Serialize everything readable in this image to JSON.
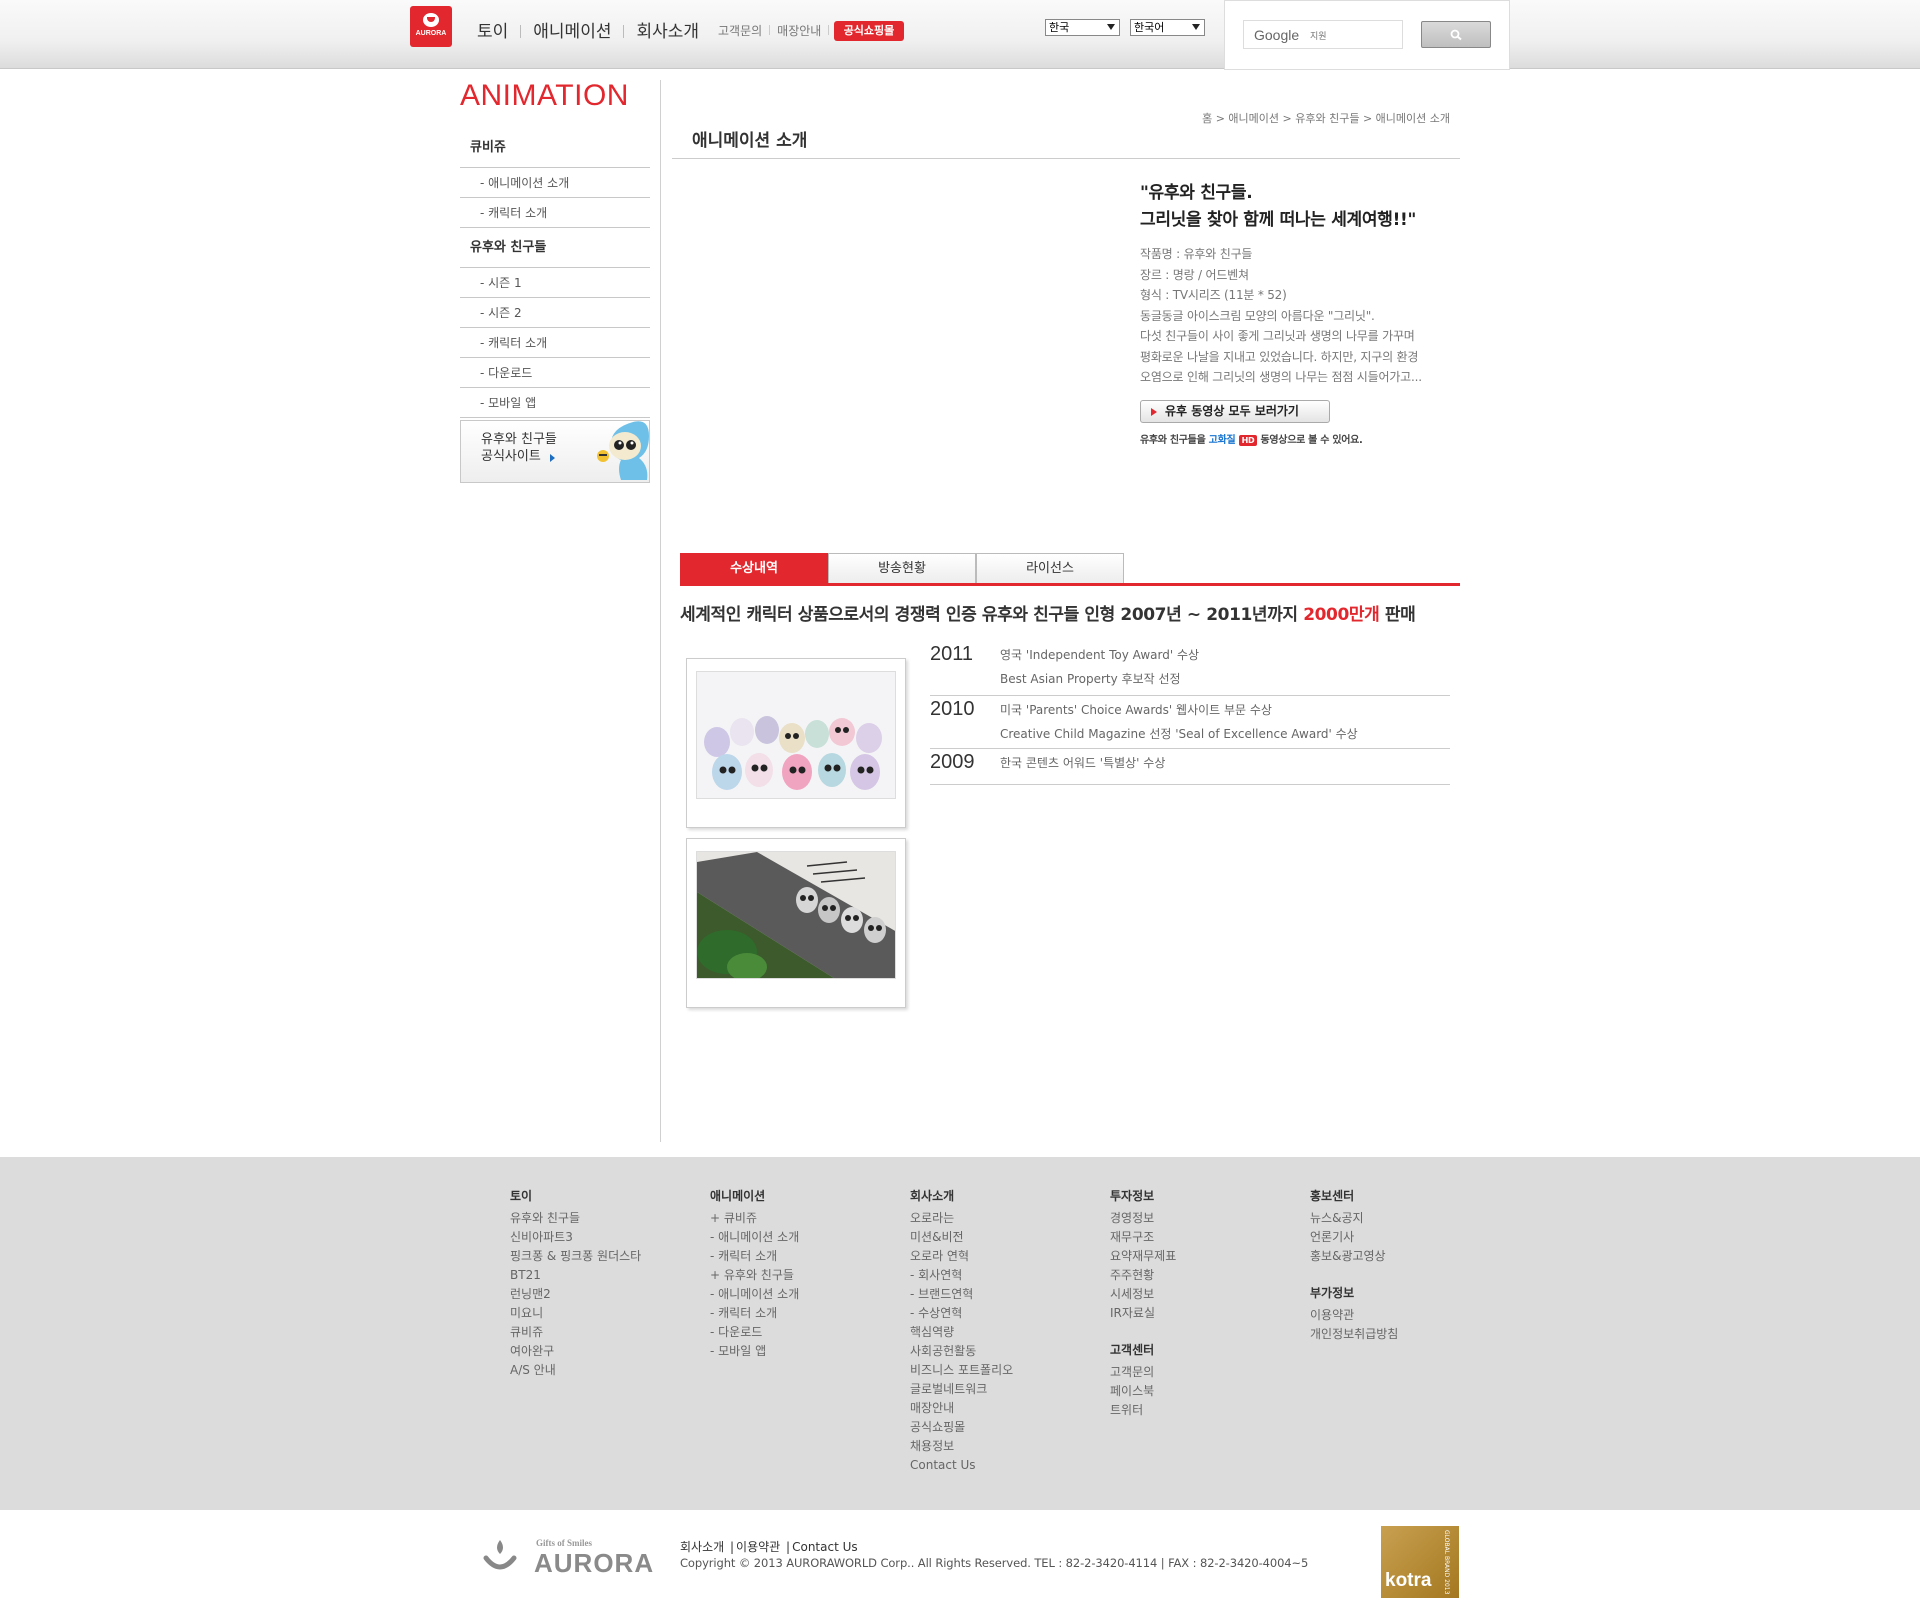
{
  "header": {
    "logo_text": "AURORA",
    "nav": [
      "토이",
      "애니메이션",
      "회사소개"
    ],
    "sub_links": [
      "고객문의",
      "매장안내"
    ],
    "shop_button": "공식쇼핑몰",
    "country_select": "한국",
    "language_select": "한국어",
    "search_brand": "Google",
    "search_placeholder": "지원"
  },
  "sidebar": {
    "title": "ANIMATION",
    "sections": [
      {
        "label": "큐비쥬",
        "items": [
          "- 애니메이션 소개",
          "- 캐릭터 소개"
        ]
      },
      {
        "label": "유후와 친구들",
        "items": [
          "- 시즌 1",
          "- 시즌 2",
          "- 캐릭터 소개",
          "- 다운로드",
          "- 모바일 앱"
        ]
      }
    ],
    "banner_line1": "유후와 친구들",
    "banner_line2": "공식사이트"
  },
  "breadcrumb": "홈 > 애니메이션 > 유후와 친구들 > 애니메이션 소개",
  "page_title": "애니메이션 소개",
  "intro": {
    "quote_line1": "\"유후와 친구들.",
    "quote_line2": "그리닛을 찾아 함께 떠나는 세계여행!!\"",
    "lines": [
      "작품명 : 유후와 친구들",
      "장르 : 명랑 / 어드벤쳐",
      "형식 : TV시리즈 (11분 * 52)",
      "동글동글 아이스크림 모양의 아름다운 \"그리닛\".",
      "다섯 친구들이 사이 좋게 그리닛과 생명의 나무를 가꾸며",
      "평화로운 나날을 지내고 있었습니다. 하지만, 지구의 환경",
      "오염으로 인해 그리닛의 생명의 나무는 점점 시들어가고..."
    ],
    "video_button": "유후 동영상 모두 보러가기",
    "hd_note_pre": "유후와 친구들을 ",
    "hd_note_blue": "고화질",
    "hd_badge": "HD",
    "hd_note_post": " 동영상으로 볼 수 있어요."
  },
  "tabs": [
    "수상내역",
    "방송현황",
    "라이선스"
  ],
  "headline_pre": "세계적인 캐릭터 상품으로서의 경쟁력 인증 유후와 친구들 인형 2007년 ~ 2011년까지 ",
  "headline_red": "2000만개",
  "headline_post": " 판매",
  "awards": [
    {
      "year": "2011",
      "items": [
        "영국 'Independent Toy Award' 수상",
        "Best Asian Property 후보작 선정"
      ]
    },
    {
      "year": "2010",
      "items": [
        "미국 'Parents' Choice Awards' 웹사이트 부문 수상",
        "Creative Child Magazine 선정 'Seal of Excellence Award' 수상"
      ]
    },
    {
      "year": "2009",
      "items": [
        "한국 콘텐츠 어워드 '특별상' 수상"
      ]
    }
  ],
  "footer": {
    "columns": [
      {
        "title": "토이",
        "items": [
          "유후와 친구들",
          "신비아파트3",
          "핑크퐁 & 핑크퐁 원더스타",
          "BT21",
          "런닝맨2",
          "미요니",
          "큐비쥬",
          "여아완구",
          "A/S 안내"
        ]
      },
      {
        "title": "애니메이션",
        "items": [
          "+ 큐비쥬",
          "- 애니메이션 소개",
          "- 캐릭터 소개",
          "+ 유후와 친구들",
          "- 애니메이션 소개",
          "- 캐릭터 소개",
          "- 다운로드",
          "- 모바일 앱"
        ]
      },
      {
        "title": "회사소개",
        "items": [
          "오로라는",
          "미션&비전",
          "오로라 연혁",
          "- 회사연혁",
          "- 브랜드연혁",
          "- 수상연혁",
          "핵심역량",
          "사회공헌활동",
          "비즈니스 포트폴리오",
          "글로벌네트워크",
          "매장안내",
          "공식쇼핑몰",
          "채용정보",
          "Contact Us"
        ]
      },
      {
        "title": "투자정보",
        "items": [
          "경영정보",
          "재무구조",
          "요약재무제표",
          "주주현황",
          "시세정보",
          "IR자료실"
        ],
        "title2": "고객센터",
        "items2": [
          "고객문의",
          "페이스북",
          "트위터"
        ]
      },
      {
        "title": "홍보센터",
        "items": [
          "뉴스&공지",
          "언론기사",
          "홍보&광고영상"
        ],
        "title2": "부가정보",
        "items2": [
          "이용약관",
          "개인정보취급방침"
        ]
      }
    ],
    "logo_tagline": "Gifts of Smiles",
    "logo_text": "AURORA",
    "links": [
      "회사소개",
      "이용약관",
      "Contact Us"
    ],
    "copyright": "Copyright © 2013 AURORAWORLD Corp.. All Rights Reserved. TEL : 82-2-3420-4114 | FAX : 82-2-3420-4004~5",
    "kotra_text": "kotra",
    "kotra_side": "GLOBAL BRAND 2013"
  },
  "colors": {
    "accent": "#e2282e",
    "link_blue": "#1673d0",
    "footer_bg": "#dcdcdc"
  }
}
